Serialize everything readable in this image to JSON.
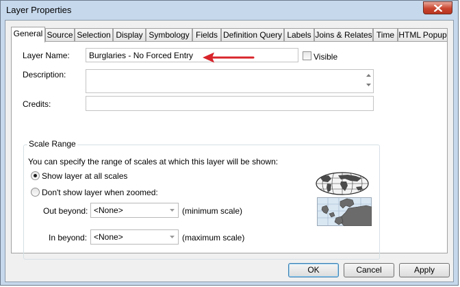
{
  "window": {
    "title": "Layer Properties"
  },
  "tabs": [
    {
      "label": "General",
      "active": true
    },
    {
      "label": "Source"
    },
    {
      "label": "Selection"
    },
    {
      "label": "Display"
    },
    {
      "label": "Symbology"
    },
    {
      "label": "Fields"
    },
    {
      "label": "Definition Query"
    },
    {
      "label": "Labels"
    },
    {
      "label": "Joins & Relates"
    },
    {
      "label": "Time"
    },
    {
      "label": "HTML Popup"
    }
  ],
  "general": {
    "layer_name_label": "Layer Name:",
    "layer_name_value": "Burglaries - No Forced Entry",
    "visible_label": "Visible",
    "visible_checked": false,
    "description_label": "Description:",
    "description_value": "",
    "credits_label": "Credits:",
    "credits_value": ""
  },
  "scale_range": {
    "group_title": "Scale Range",
    "intro": "You can specify the range of scales at which this layer will be shown:",
    "show_all_label": "Show layer at all scales",
    "dont_show_label": "Don't show layer when zoomed:",
    "selected_option": "show_all",
    "out_beyond_label": "Out beyond:",
    "out_beyond_value": "<None>",
    "out_beyond_hint": "(minimum scale)",
    "in_beyond_label": "In beyond:",
    "in_beyond_value": "<None>",
    "in_beyond_hint": "(maximum scale)"
  },
  "buttons": {
    "ok": "OK",
    "cancel": "Cancel",
    "apply": "Apply"
  },
  "colors": {
    "annotation_arrow": "#d8232a",
    "title_bar": "#c6d8ec",
    "close_button": "#c9452f"
  }
}
